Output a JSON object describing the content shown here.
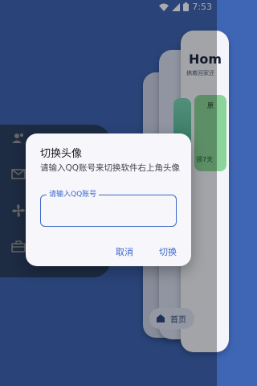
{
  "status_bar": {
    "time": "7:53",
    "icons": [
      "wifi-icon",
      "signal-icon",
      "battery-icon"
    ]
  },
  "drawer": {
    "icons": [
      "contacts-icon",
      "mail-icon",
      "fan-icon",
      "toolbox-icon"
    ]
  },
  "background_card": {
    "title": "Hom",
    "subtitle": "搞着回家还",
    "mini_card_label": "原",
    "mini_card_sub": "领7天"
  },
  "bottom_nav": {
    "home_label": "首页"
  },
  "dialog": {
    "title": "切换头像",
    "message": "请输入QQ账号来切换软件右上角头像",
    "field_label": "请输入QQ账号",
    "field_value": "",
    "cancel_label": "取消",
    "confirm_label": "切换"
  },
  "colors": {
    "background": "#3f66b5",
    "accent": "#3d68c9",
    "dialog_bg": "#f6f6fb"
  }
}
